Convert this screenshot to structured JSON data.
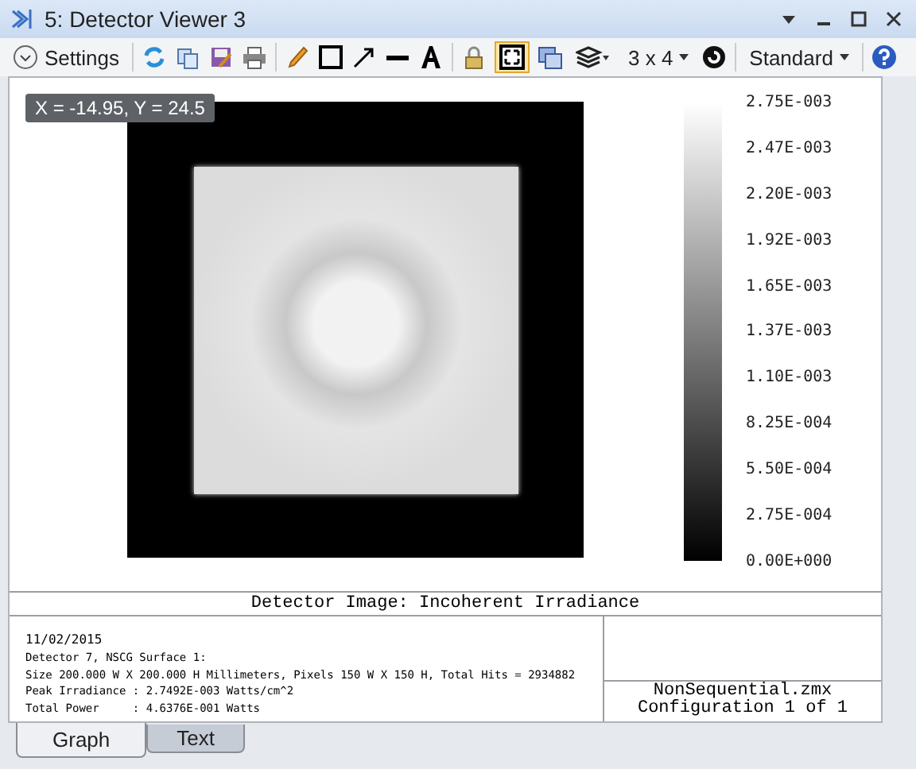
{
  "window": {
    "title": "5: Detector Viewer 3"
  },
  "toolbar": {
    "settings": "Settings",
    "layout": "3 x 4",
    "mode": "Standard"
  },
  "plot": {
    "cursor_readout": "X = -14.95, Y = 24.5",
    "legend_labels": [
      "2.75E-003",
      "2.47E-003",
      "2.20E-003",
      "1.92E-003",
      "1.65E-003",
      "1.37E-003",
      "1.10E-003",
      "8.25E-004",
      "5.50E-004",
      "2.75E-004",
      "0.00E+000"
    ],
    "caption": "Detector Image: Incoherent Irradiance"
  },
  "info": {
    "lines": [
      "11/02/2015",
      "Detector 7, NSCG Surface 1:",
      "Size 200.000 W X 200.000 H Millimeters, Pixels 150 W X 150 H, Total Hits = 2934882",
      "Peak Irradiance : 2.7492E-003 Watts/cm^2",
      "Total Power     : 4.6376E-001 Watts"
    ],
    "file": "NonSequential.zmx",
    "config": "Configuration 1 of 1"
  },
  "tabs": [
    {
      "label": "Graph",
      "selected": true
    },
    {
      "label": "Text",
      "selected": false
    }
  ]
}
